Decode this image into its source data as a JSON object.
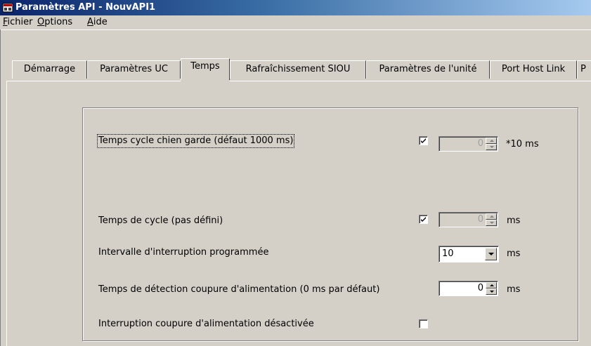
{
  "window": {
    "title": "Paramètres API - NouvAPI1",
    "title_icon": "plc-settings-icon"
  },
  "menu": [
    {
      "prefix": "",
      "accel": "F",
      "rest": "ichier"
    },
    {
      "prefix": "",
      "accel": "O",
      "rest": "ptions"
    },
    {
      "prefix": "",
      "accel": "A",
      "rest": "ide"
    }
  ],
  "tabs": [
    {
      "label": "Démarrage",
      "active": false
    },
    {
      "label": "Paramètres UC",
      "active": false
    },
    {
      "label": "Temps",
      "active": true
    },
    {
      "label": "Rafraîchissement SIOU",
      "active": false
    },
    {
      "label": "Paramètres de l'unité",
      "active": false
    },
    {
      "label": "Port Host Link",
      "active": false
    },
    {
      "label": "P",
      "active": false
    }
  ],
  "settings": {
    "watchdog": {
      "label": "Temps cycle chien garde (défaut 1000 ms)",
      "checked": true,
      "value": "0",
      "unit": "*10 ms"
    },
    "cycle_time": {
      "label": "Temps de cycle (pas défini)",
      "checked": true,
      "value": "0",
      "unit": "ms"
    },
    "scheduled_interrupt": {
      "label": "Intervalle d'interruption programmée",
      "value": "10",
      "unit": "ms"
    },
    "power_off_detection": {
      "label": "Temps de détection coupure d'alimentation (0 ms par défaut)",
      "value": "0",
      "unit": "ms"
    },
    "power_off_interrupt": {
      "label": "Interruption coupure d'alimentation désactivée",
      "checked": false
    }
  }
}
